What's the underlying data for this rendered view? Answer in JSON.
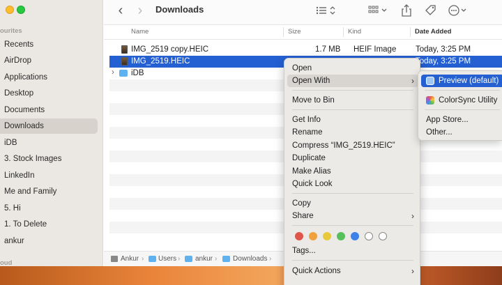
{
  "sidebar": {
    "section_favourites": "ourites",
    "items": [
      {
        "label": "Recents"
      },
      {
        "label": "AirDrop"
      },
      {
        "label": "Applications"
      },
      {
        "label": "Desktop"
      },
      {
        "label": "Documents"
      },
      {
        "label": "Downloads"
      },
      {
        "label": "iDB"
      },
      {
        "label": "3. Stock Images"
      },
      {
        "label": "LinkedIn"
      },
      {
        "label": "Me and Family"
      },
      {
        "label": "5. Hi"
      },
      {
        "label": "1. To Delete"
      },
      {
        "label": "ankur"
      }
    ],
    "section_cloud": "oud"
  },
  "toolbar": {
    "back": "‹",
    "forward": "›",
    "title": "Downloads"
  },
  "columns": {
    "name": "Name",
    "size": "Size",
    "kind": "Kind",
    "date": "Date Added"
  },
  "files": [
    {
      "name": "IMG_2519 copy.HEIC",
      "size": "1.7 MB",
      "kind": "HEIF Image",
      "date": "Today, 3:25 PM"
    },
    {
      "name": "IMG_2519.HEIC",
      "size": "",
      "kind": "",
      "date": "Today, 3:25 PM"
    },
    {
      "name": "iDB",
      "size": "",
      "kind": "",
      "date": ""
    }
  ],
  "path": [
    "Ankur",
    "Users",
    "ankur",
    "Downloads"
  ],
  "context_menu": {
    "open": "Open",
    "open_with": "Open With",
    "move_to_bin": "Move to Bin",
    "get_info": "Get Info",
    "rename": "Rename",
    "compress": "Compress “IMG_2519.HEIC”",
    "duplicate": "Duplicate",
    "make_alias": "Make Alias",
    "quick_look": "Quick Look",
    "copy": "Copy",
    "share": "Share",
    "tags": "Tags...",
    "quick_actions": "Quick Actions",
    "tag_colors": [
      "#e0564a",
      "#f0a03c",
      "#e8c93c",
      "#58c05a",
      "#3d82e8",
      "#ffffff",
      "#ffffff"
    ]
  },
  "submenu": {
    "preview": "Preview (default)",
    "colorsync": "ColorSync Utility",
    "app_store": "App Store...",
    "other": "Other..."
  },
  "colors": {
    "selection": "#2460d2"
  }
}
